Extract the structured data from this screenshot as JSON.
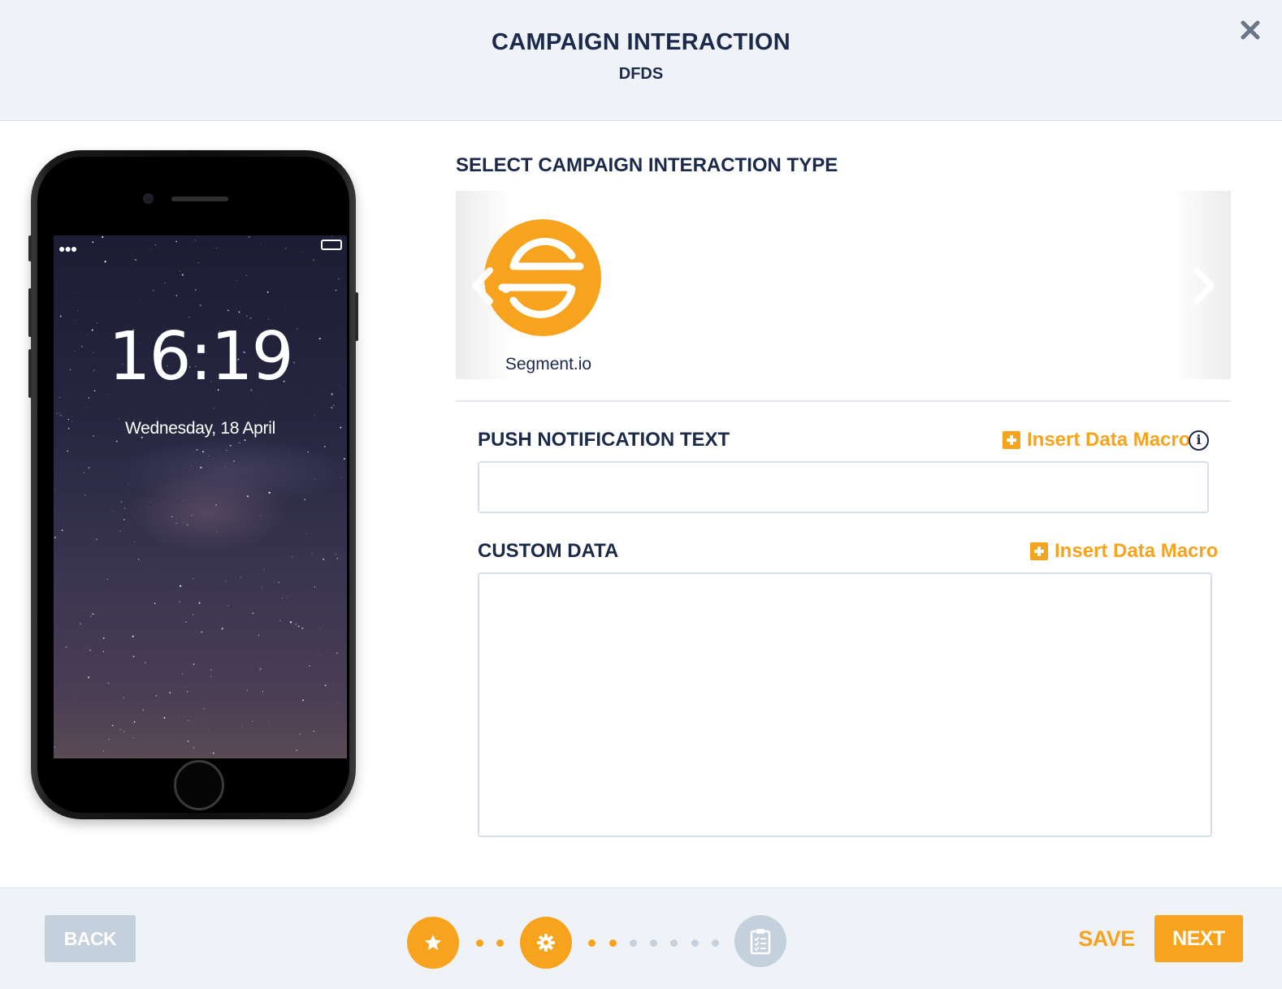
{
  "header": {
    "title": "CAMPAIGN INTERACTION",
    "subtitle": "DFDS",
    "close_icon": "close-icon"
  },
  "phone_preview": {
    "time": "16:19",
    "date": "Wednesday, 18 April",
    "status_icons": [
      "signal-dots-icon",
      "battery-icon"
    ]
  },
  "interaction_type": {
    "title": "SELECT CAMPAIGN INTERACTION TYPE",
    "options": [
      {
        "label": "Segment.io",
        "icon": "segment-logo-icon",
        "color": "#f8a31e"
      }
    ],
    "nav_icons": [
      "chevron-left-icon",
      "chevron-right-icon"
    ]
  },
  "push_notification": {
    "label": "PUSH NOTIFICATION TEXT",
    "macro_link": "Insert Data Macro",
    "value": "",
    "info_icon": "i"
  },
  "custom_data": {
    "label": "CUSTOM DATA",
    "macro_link": "Insert Data Macro",
    "value": ""
  },
  "footer": {
    "back_label": "BACK",
    "save_label": "SAVE",
    "next_label": "NEXT",
    "steps": [
      {
        "icon": "star-icon",
        "state": "complete"
      },
      {
        "icon": "gear-icon",
        "state": "current"
      },
      {
        "icon": "clipboard-icon",
        "state": "pending"
      }
    ]
  },
  "colors": {
    "accent": "#f8a31e",
    "navy": "#1b2a4a",
    "header_bg": "#eff2f7",
    "disabled": "#c5d0dd"
  }
}
